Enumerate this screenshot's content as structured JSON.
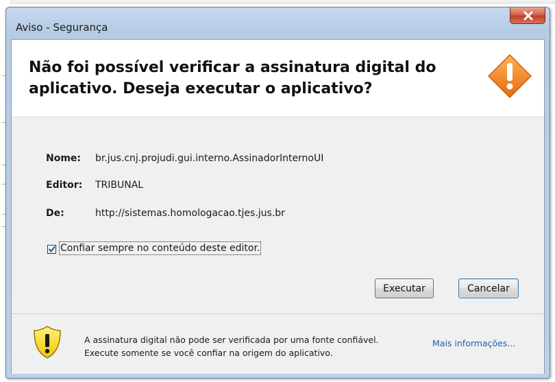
{
  "window": {
    "title": "Aviso - Segurança"
  },
  "header": {
    "message": "Não foi possível verificar a assinatura digital do\naplicativo.  Deseja executar o aplicativo?",
    "icon": "warning-icon"
  },
  "details": [
    {
      "label": "Nome:",
      "value": "br.jus.cnj.projudi.gui.interno.AssinadorInternoUI"
    },
    {
      "label": "Editor:",
      "value": "TRIBUNAL"
    },
    {
      "label": "De:",
      "value": "http://sistemas.homologacao.tjes.jus.br"
    }
  ],
  "trust_checkbox": {
    "label": "Confiar sempre no conteúdo deste editor.",
    "checked": true
  },
  "buttons": {
    "execute": "Executar",
    "cancel": "Cancelar"
  },
  "footer": {
    "line1": "A assinatura digital não pode ser verificada por uma fonte confiável.",
    "line2": "Execute somente se você confiar na origem do aplicativo.",
    "link": "Mais informações...",
    "icon": "shield-warning-icon"
  },
  "colors": {
    "accent_warning": "#f28a1e",
    "link": "#1a5fa8",
    "close_button": "#c8442e"
  }
}
